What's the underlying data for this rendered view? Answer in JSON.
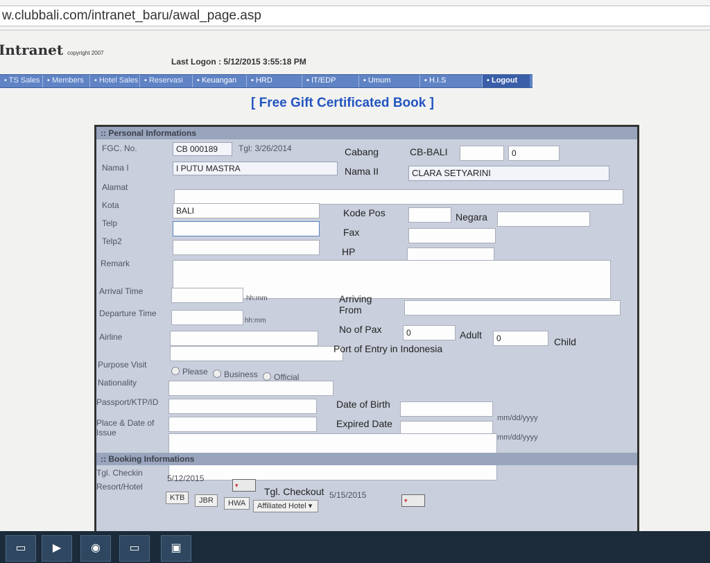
{
  "browser": {
    "url": "w.clubbali.com/intranet_baru/awal_page.asp"
  },
  "header": {
    "logo": "Intranet",
    "copyright": "copyright 2007",
    "last_logon": "Last Logon : 5/12/2015 3:55:18 PM"
  },
  "menu": [
    {
      "label": "TS Sales"
    },
    {
      "label": "Members"
    },
    {
      "label": "Hotel Sales"
    },
    {
      "label": "Reservasi"
    },
    {
      "label": "Keuangan"
    },
    {
      "label": "HRD"
    },
    {
      "label": "IT/EDP"
    },
    {
      "label": "Umum"
    },
    {
      "label": "H.I.S"
    },
    {
      "label": "Logout"
    }
  ],
  "page_title": "[ Free Gift Certificated Book ]",
  "personal": {
    "header": ":: Personal Informations",
    "fgc_label": "FGC. No.",
    "fgc_value": "CB 000189",
    "tgl": "Tgl: 3/26/2014",
    "cabang_label": "Cabang",
    "cabang_value": "CB-BALI",
    "cabang_input2": "0",
    "nama1_label": "Nama I",
    "nama1_value": "I PUTU MASTRA",
    "nama2_label": "Nama II",
    "nama2_value": "CLARA SETYARINI",
    "alamat_label": "Alamat",
    "kota_label": "Kota",
    "kota_value": "BALI",
    "kodepos_label": "Kode Pos",
    "negara_label": "Negara",
    "telp_label": "Telp",
    "fax_label": "Fax",
    "telp2_label": "Telp2",
    "hp_label": "HP",
    "remark_label": "Remark",
    "arrival_label": "Arrival Time",
    "hhmm": "hh:mm",
    "arriving_from_label": "Arriving From",
    "departure_label": "Departure Time",
    "nopax_label": "No of Pax",
    "pax_adult": "0",
    "adult_label": "Adult",
    "pax_child": "0",
    "child_label": "Child",
    "airline_label": "Airline",
    "port_entry_label": "Port of Entry in Indonesia",
    "purpose_label": "Purpose Visit",
    "purpose_options": [
      "Please",
      "Business",
      "Official"
    ],
    "nationality_label": "Nationality",
    "passport_label": "Passport/KTP/ID",
    "dob_label": "Date of Birth",
    "date_fmt": "mm/dd/yyyy",
    "place_label": "Place & Date of Issue",
    "expired_label": "Expired Date"
  },
  "booking": {
    "header": ":: Booking Informations",
    "checkin_label": "Tgl. Checkin",
    "checkin_value": "5/12/2015",
    "checkout_label": "Tgl. Checkout",
    "checkout_value": "5/15/2015",
    "resort_label": "Resort/Hotel",
    "resorts": [
      "KTB",
      "JBR",
      "HWA"
    ],
    "affiliated": "Affiliated Hotel"
  }
}
